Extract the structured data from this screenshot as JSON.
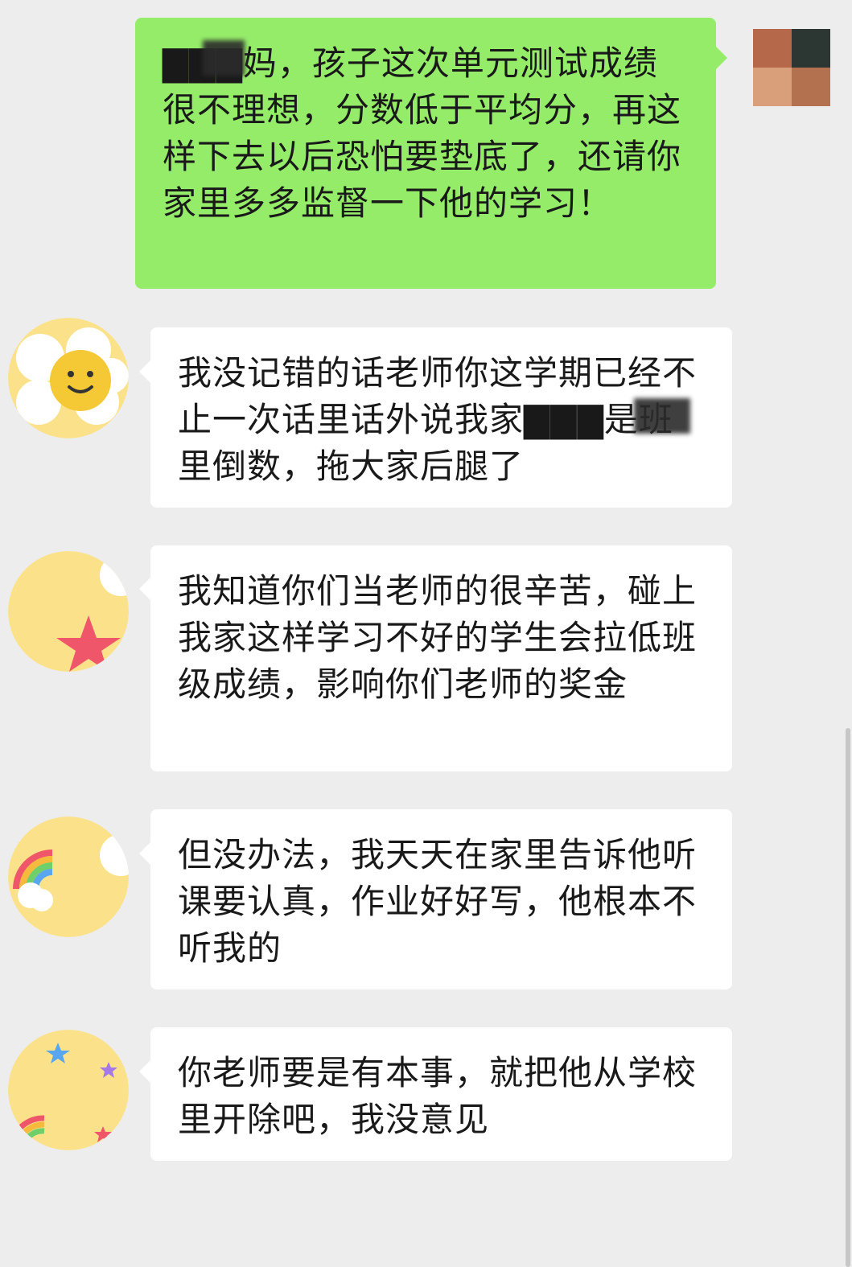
{
  "messages": [
    {
      "side": "sent",
      "text": "▇▇▇妈，孩子这次单元测试成绩很不理想，分数低于平均分，再这样下去以后恐怕要垫底了，还请你家里多多监督一下他的学习！"
    },
    {
      "side": "received",
      "text": "我没记错的话老师你这学期已经不止一次话里话外说我家▇▇▇是班里倒数，拖大家后腿了"
    },
    {
      "side": "received",
      "text": "我知道你们当老师的很辛苦，碰上我家这样学习不好的学生会拉低班级成绩，影响你们老师的奖金"
    },
    {
      "side": "received",
      "text": "但没办法，我天天在家里告诉他听课要认真，作业好好写，他根本不听我的"
    },
    {
      "side": "received",
      "text": "你老师要是有本事，就把他从学校里开除吧，我没意见"
    }
  ],
  "avatars": [
    {
      "icon": "pixelated-avatar-icon"
    },
    {
      "icon": "smiley-flower-avatar-icon"
    },
    {
      "icon": "star-avatar-icon"
    },
    {
      "icon": "rainbow-avatar-icon"
    },
    {
      "icon": "stars-rainbow-avatar-icon"
    }
  ],
  "colors": {
    "background": "#ededed",
    "sent_bubble": "#95ec69",
    "received_bubble": "#ffffff",
    "text": "#191919"
  }
}
